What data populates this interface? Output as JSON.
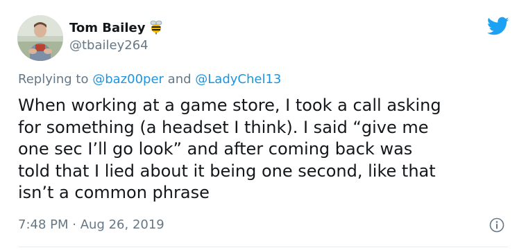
{
  "author": {
    "display_name": "Tom Bailey",
    "handle": "@tbailey264",
    "name_emoji": "bee-icon"
  },
  "reply": {
    "prefix": "Replying to",
    "mention_1": "@baz00per",
    "joiner": "and",
    "mention_2": "@LadyChel13"
  },
  "tweet": {
    "lines": [
      "When working at a game store, I took a call asking",
      "for something (a headset I think). I said “give me",
      "one sec I’ll go look” and after coming back was",
      "told that I lied about it being one second, like that",
      "isn’t a common phrase"
    ]
  },
  "meta": {
    "time": "7:48 PM",
    "separator": "·",
    "date": "Aug 26, 2019"
  },
  "colors": {
    "twitter_blue": "#1da1f2",
    "mention_blue": "#1b95e0",
    "secondary_text": "#657786",
    "primary_text": "#14171a"
  },
  "icons": [
    "twitter-logo-icon",
    "info-icon",
    "bee-icon"
  ]
}
